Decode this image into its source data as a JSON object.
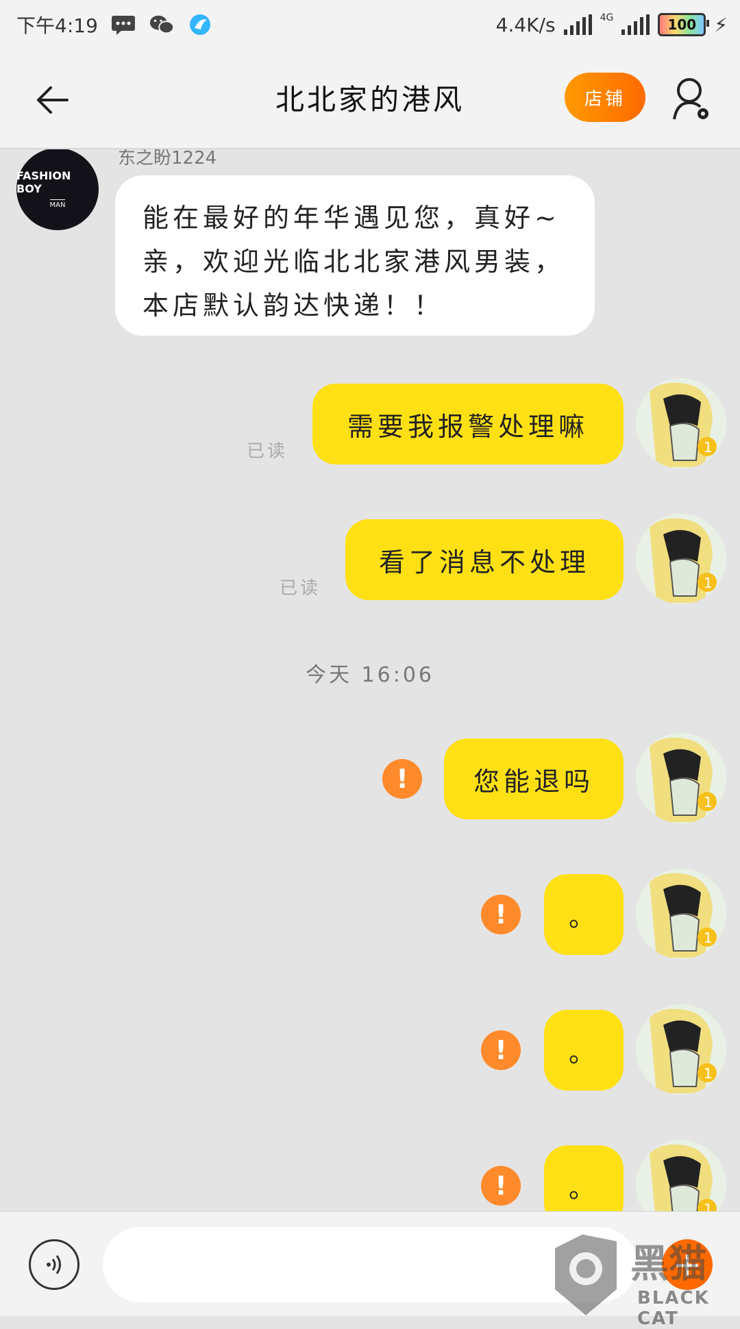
{
  "status_bar": {
    "time": "下午4:19",
    "network_speed": "4.4K/s",
    "network_type": "4G",
    "battery": "100",
    "icons": [
      "message-icon",
      "wechat-icon",
      "app-bird-icon"
    ]
  },
  "header": {
    "title": "北北家的港风",
    "shop_button": "店铺",
    "back_icon": "arrow-left-icon",
    "profile_icon": "user-settings-icon"
  },
  "chat": {
    "sender_name": "东之盼1224",
    "shop_avatar": {
      "line1": "FASHION BOY",
      "line2": "MAN"
    },
    "incoming_message": "能在最好的年华遇见您，真好~亲，欢迎光临北北家港风男装，本店默认韵达快递！！",
    "messages": [
      {
        "text": "需要我报警处理嘛",
        "status": "已读"
      },
      {
        "text": "看了消息不处理",
        "status": "已读"
      },
      {
        "text": "您能退吗",
        "status": "!"
      },
      {
        "text": "。",
        "status": "!"
      },
      {
        "text": "。",
        "status": "!"
      },
      {
        "text": "。",
        "status": "!"
      }
    ],
    "timestamp": "今天 16:06"
  },
  "input": {
    "placeholder": "",
    "voice_icon": "voice-icon",
    "plus_icon": "plus-icon"
  },
  "watermark": {
    "text": "BLACK CAT",
    "logo": "黑猫"
  },
  "colors": {
    "outgoing_bubble": "#ffe014",
    "accent": "#ff6a00",
    "warning": "#ff8a2b"
  }
}
